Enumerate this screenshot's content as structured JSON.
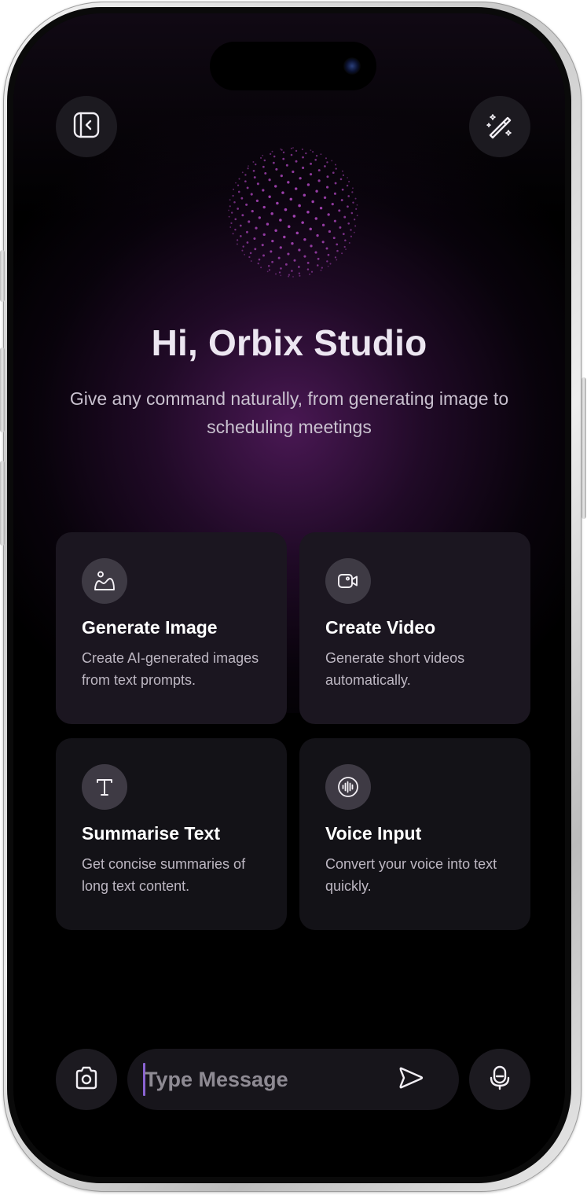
{
  "top_bar": {
    "sidebar_icon": "sidebar-collapse-icon",
    "magic_icon": "magic-wand-icon"
  },
  "greeting": {
    "title": "Hi, Orbix Studio",
    "subtitle": "Give any command naturally, from generating image to scheduling meetings"
  },
  "cards": [
    {
      "title": "Generate Image",
      "description": "Create AI-generated images from text prompts.",
      "icon": "image-icon"
    },
    {
      "title": "Create Video",
      "description": "Generate short videos automatically.",
      "icon": "video-camera-icon"
    },
    {
      "title": "Summarise Text",
      "description": "Get concise summaries of long text content.",
      "icon": "text-icon"
    },
    {
      "title": "Voice Input",
      "description": "Convert your voice into text quickly.",
      "icon": "voice-wave-icon"
    }
  ],
  "composer": {
    "placeholder": "Type Message",
    "camera_icon": "camera-icon",
    "send_icon": "send-icon",
    "mic_icon": "microphone-icon"
  },
  "colors": {
    "accent": "#8a63d2",
    "glow": "#561c62",
    "orb_dots": "#a844b8",
    "card_bg": "#1b1620"
  }
}
